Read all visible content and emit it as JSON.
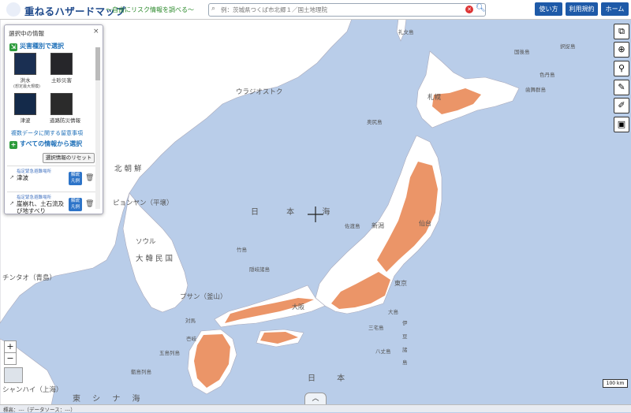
{
  "header": {
    "title": "重ねるハザードマップ",
    "subtitle": "〜自由にリスク情報を調べる〜",
    "search_placeholder": "例：茨城県つくば市北郷１／国土地理院",
    "buttons": [
      {
        "label": "使い方"
      },
      {
        "label": "利用規約"
      },
      {
        "label": "ホーム"
      }
    ]
  },
  "panel": {
    "title": "選択中の情報",
    "by_disaster_label": "災害種別で選択",
    "hazards": [
      {
        "label": "洪水",
        "sub": "(想定最大規模)"
      },
      {
        "label": "土砂災害",
        "sub": ""
      },
      {
        "label": "津波",
        "sub": ""
      },
      {
        "label": "道路防災情報",
        "sub": ""
      }
    ],
    "notice_link": "複数データに関する留意事項",
    "all_info_label": "すべての情報から選択",
    "reset_label": "選択情報のリセット",
    "selected": [
      {
        "category": "指定緊急避難場所",
        "name": "津波",
        "legend": "解説 凡例"
      },
      {
        "category": "指定緊急避難場所",
        "name": "崖崩れ、土石流及び地すべり",
        "legend": "解説 凡例"
      }
    ]
  },
  "map_labels": {
    "cities": [
      "ウラジオストク",
      "ピョンヤン（平壌）",
      "ソウル",
      "プサン（釜山）",
      "チンタオ（青島）",
      "シャンハイ（上海）",
      "札幌",
      "仙台",
      "新潟",
      "東京",
      "大阪"
    ],
    "regions": [
      "北 朝 鮮",
      "大 韓 民 国",
      "日 本 海",
      "日 本",
      "東 シ ナ 海"
    ],
    "islands": [
      "礼文島",
      "国後島",
      "択捉島",
      "色丹島",
      "歯舞群島",
      "奥尻島",
      "佐渡島",
      "竹島",
      "隠岐諸島",
      "対馬",
      "壱岐",
      "五島列島",
      "甑島列島",
      "大島",
      "三宅島",
      "八丈島",
      "伊",
      "豆",
      "諸",
      "島"
    ]
  },
  "scale_label": "100 km",
  "status_text": "標高：---（データソース：---）",
  "colors": {
    "header_button": "#1e5aa8",
    "hazard_fill": "#e8834e",
    "sea": "#b9cde9",
    "land": "#ffffff"
  }
}
